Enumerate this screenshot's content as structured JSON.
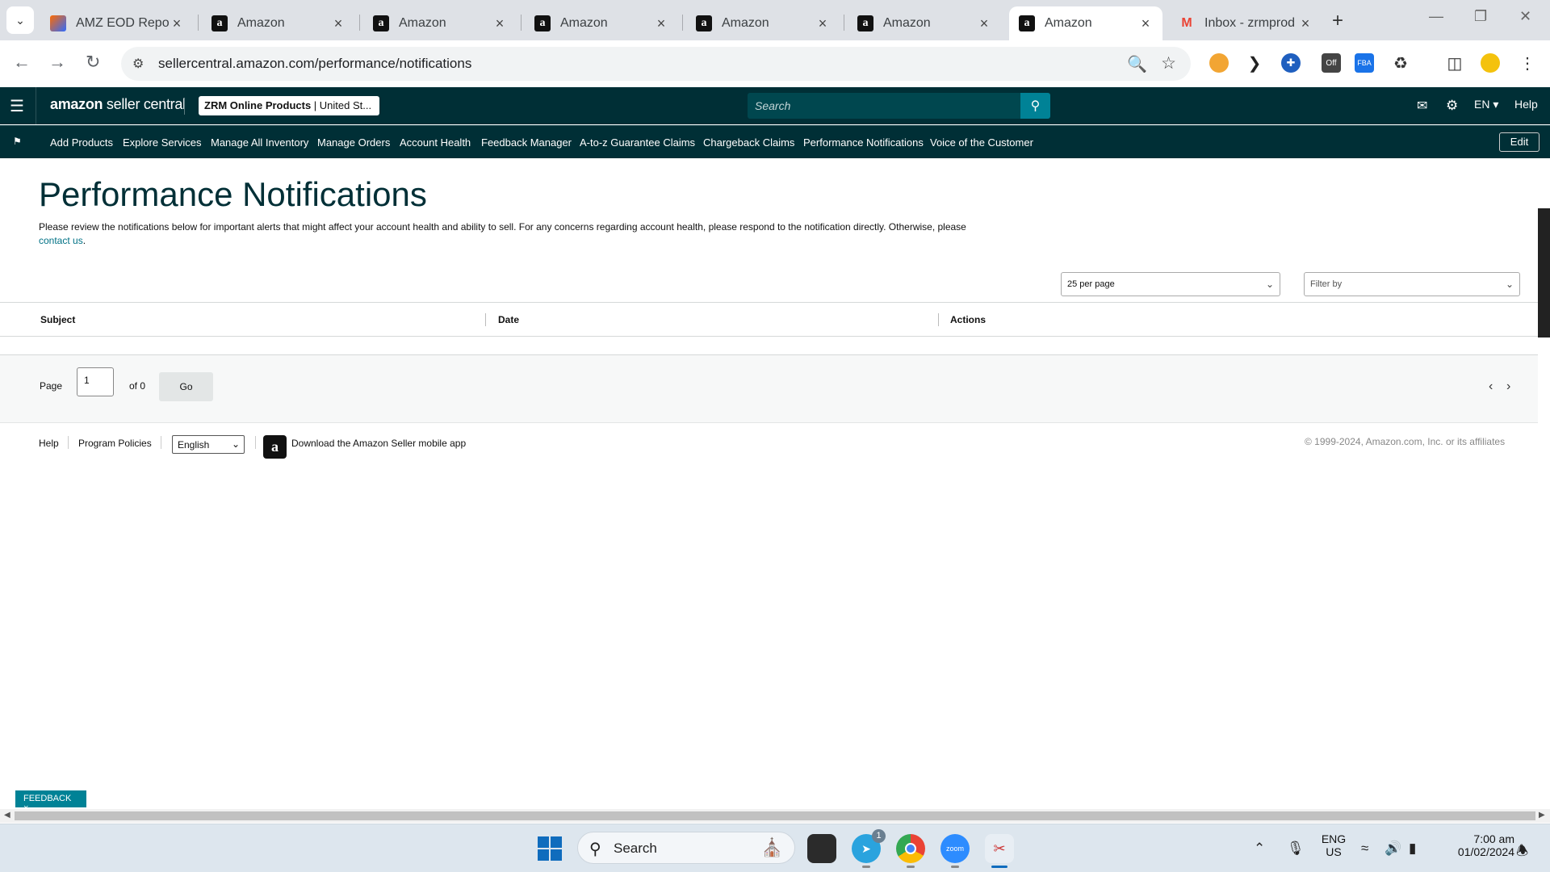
{
  "browser": {
    "tabs": [
      {
        "title": "AMZ EOD Report",
        "icon": "amz-eod-icon"
      },
      {
        "title": "Amazon",
        "icon": "amazon-icon"
      },
      {
        "title": "Amazon",
        "icon": "amazon-icon"
      },
      {
        "title": "Amazon",
        "icon": "amazon-icon"
      },
      {
        "title": "Amazon",
        "icon": "amazon-icon"
      },
      {
        "title": "Amazon",
        "icon": "amazon-icon"
      },
      {
        "title": "Amazon",
        "icon": "amazon-icon",
        "active": true
      },
      {
        "title": "Inbox - zrmprod",
        "icon": "gmail-icon"
      }
    ],
    "url": "sellercentral.amazon.com/performance/notifications",
    "extension_badge": "Off"
  },
  "header": {
    "logo_bold": "amazon",
    "logo_thin": " seller central",
    "account_name": "ZRM Online Products",
    "account_region": "| United St...",
    "search_placeholder": "Search",
    "language": "EN",
    "help": "Help"
  },
  "nav": {
    "links": [
      "Add Products",
      "Explore Services",
      "Manage All Inventory",
      "Manage Orders",
      "Account Health",
      "Feedback Manager",
      "A-to-z Guarantee Claims",
      "Chargeback Claims",
      "Performance Notifications",
      "Voice of the Customer"
    ],
    "edit": "Edit"
  },
  "main": {
    "title": "Performance Notifications",
    "description": "Please review the notifications below for important alerts that might affect your account health and ability to sell. For any concerns regarding account health, please respond to the notification directly. Otherwise, please",
    "contact_link": "contact us",
    "per_page": "25 per page",
    "filter_placeholder": "Filter by",
    "columns": [
      "Subject",
      "Date",
      "Actions"
    ],
    "pager": {
      "page_label": "Page",
      "page_value": "1",
      "of_label": "of 0",
      "go": "Go"
    }
  },
  "footer": {
    "help": "Help",
    "program_policies": "Program Policies",
    "language": "English",
    "app_text": "Download the Amazon Seller mobile app",
    "copyright": "© 1999-2024, Amazon.com, Inc. or its affiliates"
  },
  "feedback_tag": "FEEDBACK ×",
  "taskbar": {
    "search_label": "Search",
    "telegram_badge": "1",
    "zoom_label": "zoom",
    "lang_top": "ENG",
    "lang_bottom": "US",
    "time": "7:00 am",
    "date": "01/02/2024"
  },
  "colors": {
    "header_bg": "#002f36",
    "accent_teal": "#008296",
    "link": "#007185"
  }
}
